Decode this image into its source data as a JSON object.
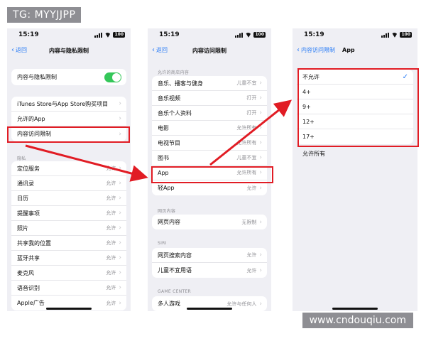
{
  "watermarks": {
    "top": "TG: MYYJJPP",
    "bottom": "www.cndouqiu.com"
  },
  "colors": {
    "accent": "#2a7cf6",
    "toggle_on": "#34c759",
    "highlight": "#e11c24"
  },
  "status": {
    "time": "15:19",
    "battery": "100"
  },
  "panel1": {
    "back": "返回",
    "title": "内容与隐私限制",
    "toggle_row": {
      "label": "内容与隐私限制",
      "on": true
    },
    "group1": [
      {
        "label": "iTunes Store与App Store购买项目"
      },
      {
        "label": "允许的App"
      },
      {
        "label": "内容访问限制"
      }
    ],
    "privacy_header": "隐私",
    "privacy": [
      {
        "label": "定位服务",
        "value": "允许"
      },
      {
        "label": "通讯录",
        "value": "允许"
      },
      {
        "label": "日历",
        "value": "允许"
      },
      {
        "label": "提醒事项",
        "value": "允许"
      },
      {
        "label": "照片",
        "value": "允许"
      },
      {
        "label": "共享我的位置",
        "value": "允许"
      },
      {
        "label": "蓝牙共享",
        "value": "允许"
      },
      {
        "label": "麦克风",
        "value": "允许"
      },
      {
        "label": "语音识别",
        "value": "允许"
      },
      {
        "label": "Apple广告",
        "value": "允许"
      }
    ]
  },
  "panel2": {
    "back": "返回",
    "title": "内容访问限制",
    "store_header": "允许的商店内容",
    "store": [
      {
        "label": "音乐、播客与健身",
        "value": "儿童不宜"
      },
      {
        "label": "音乐视频",
        "value": "打开"
      },
      {
        "label": "音乐个人资料",
        "value": "打开"
      },
      {
        "label": "电影",
        "value": "允许所有"
      },
      {
        "label": "电视节目",
        "value": "允许所有"
      },
      {
        "label": "图书",
        "value": "儿童不宜"
      },
      {
        "label": "App",
        "value": "允许所有"
      },
      {
        "label": "轻App",
        "value": "允许"
      }
    ],
    "web_header": "网页内容",
    "web": [
      {
        "label": "网页内容",
        "value": "无限制"
      }
    ],
    "siri_header": "SIRI",
    "siri": [
      {
        "label": "网页搜索内容",
        "value": "允许"
      },
      {
        "label": "儿童不宜用语",
        "value": "允许"
      }
    ],
    "gc_header": "GAME CENTER",
    "gc": [
      {
        "label": "多人游戏",
        "value": "允许与任何人"
      }
    ]
  },
  "panel3": {
    "back": "内容访问限制",
    "title": "App",
    "ratings": [
      {
        "label": "不允许",
        "checked": true
      },
      {
        "label": "4+"
      },
      {
        "label": "9+"
      },
      {
        "label": "12+"
      },
      {
        "label": "17+"
      }
    ],
    "allow_all": "允许所有"
  }
}
